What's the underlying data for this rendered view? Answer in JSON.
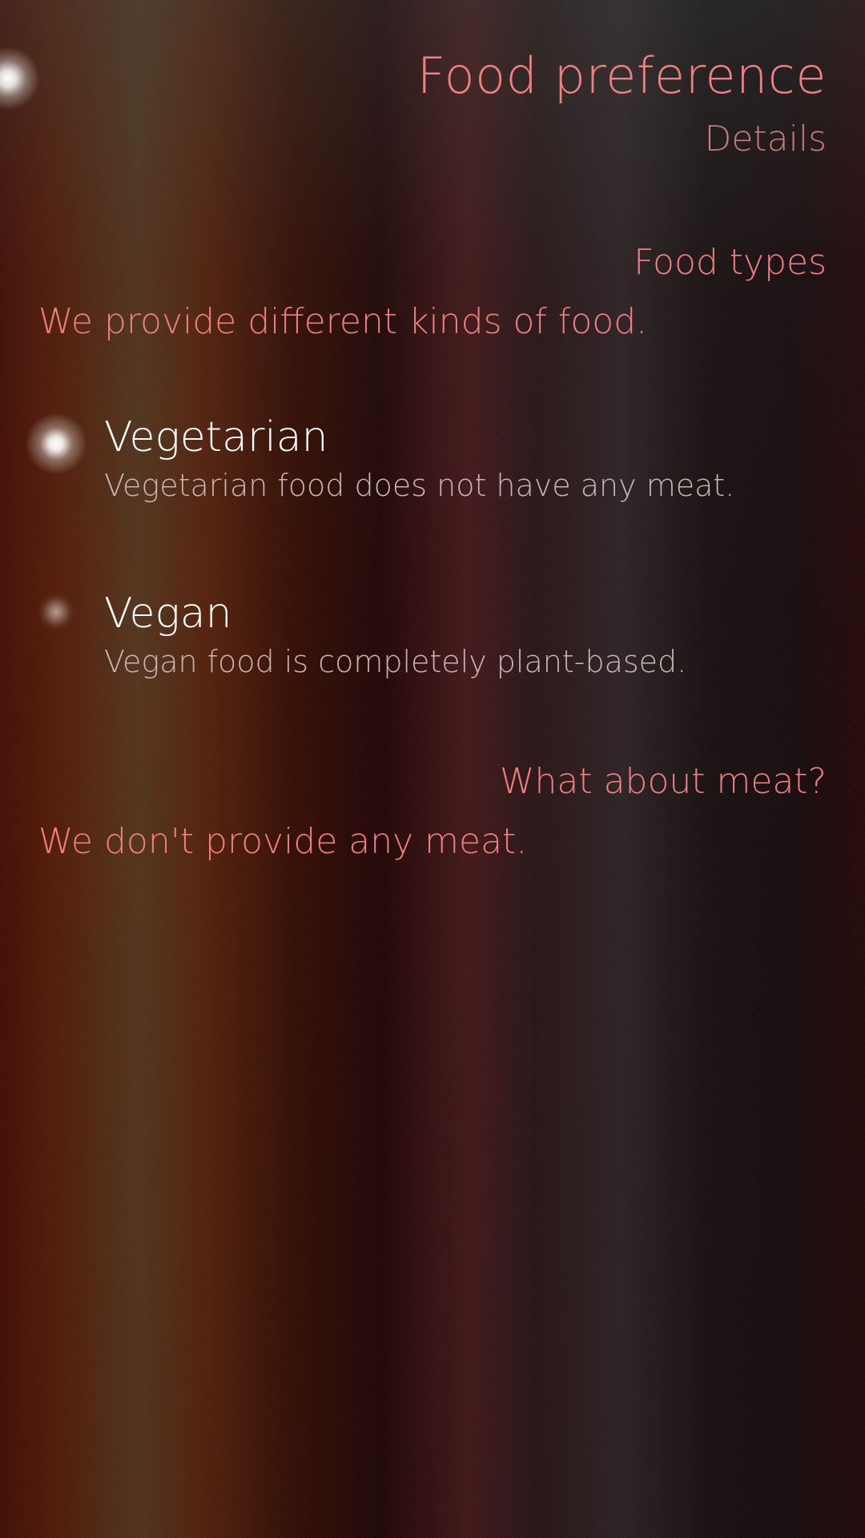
{
  "page": {
    "title": "Food preference",
    "subtitle": "Details"
  },
  "sections": [
    {
      "header": "Food types",
      "text": "We provide different kinds of food."
    },
    {
      "header": "What about meat?",
      "text": "We don't provide any meat."
    }
  ],
  "options": [
    {
      "label": "Vegetarian",
      "description": "Vegetarian food does not have any meat.",
      "selected": true
    },
    {
      "label": "Vegan",
      "description": "Vegan food is completely plant-based.",
      "selected": false
    }
  ],
  "colors": {
    "highlight": "#f07f80",
    "primary_text": "#ffffff",
    "secondary_text": "#c8b6b6"
  }
}
